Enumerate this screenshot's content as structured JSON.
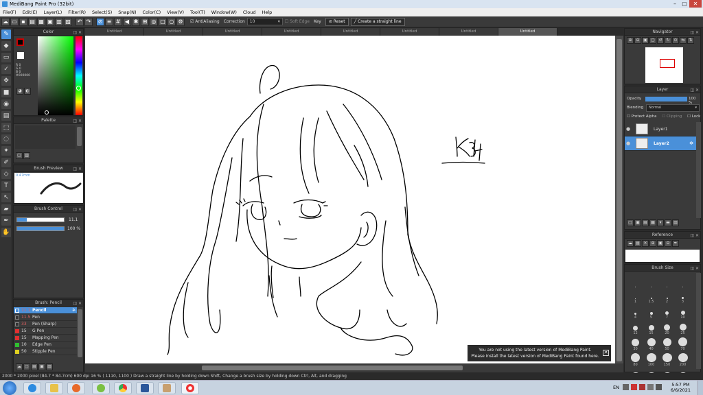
{
  "window": {
    "title": "MediBang Paint Pro (32bit)",
    "minimize": "–",
    "maximize": "▢",
    "close": "✕"
  },
  "menu": [
    "File(F)",
    "Edit(E)",
    "Layer(L)",
    "Filter(R)",
    "Select(S)",
    "Snap(N)",
    "Color(C)",
    "View(V)",
    "Tool(T)",
    "Window(W)",
    "Cloud",
    "Help"
  ],
  "toolbar": {
    "antialias_label": "AntiAliasing",
    "correction_label": "Correction",
    "correction_value": "10",
    "soft_edge_label": "Soft Edge",
    "key_label": "Key",
    "reset_label": "Reset",
    "straight_line_label": "Create a straight line"
  },
  "tabs": [
    "Untitled",
    "Untitled",
    "Untitled",
    "Untitled",
    "Untitled",
    "Untitled",
    "Untitled",
    "Untitled"
  ],
  "color_panel": {
    "title": "Color",
    "r": "R 0",
    "g": "G 0",
    "b": "B 0",
    "hex": "#000000"
  },
  "palette_panel": {
    "title": "Palette"
  },
  "brush_preview": {
    "title": "Brush Preview",
    "size": "0.47mm"
  },
  "brush_control": {
    "title": "Brush Control",
    "size_value": "11.1",
    "opacity_value": "100 %"
  },
  "brush_list": {
    "title": "Brush: Pencil",
    "items": [
      {
        "size": "11.1",
        "name": "Pencil",
        "color": "#4a90d9"
      },
      {
        "size": "11.5",
        "name": "Pen",
        "color": "#333333"
      },
      {
        "size": "33",
        "name": "Pen (Sharp)",
        "color": "#333333"
      },
      {
        "size": "15",
        "name": "G Pen",
        "color": "#e03030"
      },
      {
        "size": "15",
        "name": "Mapping Pen",
        "color": "#e03030"
      },
      {
        "size": "10",
        "name": "Edge Pen",
        "color": "#30c030"
      },
      {
        "size": "50",
        "name": "Stipple Pen",
        "color": "#e0d020"
      }
    ]
  },
  "navigator": {
    "title": "Navigator"
  },
  "layer_panel": {
    "title": "Layer",
    "opacity_label": "Opacity",
    "opacity_value": "100 %",
    "blending_label": "Blending",
    "blending_value": "Normal",
    "protect_alpha": "Protect Alpha",
    "clipping": "Clipping",
    "lock": "Lock",
    "layers": [
      {
        "name": "Layer1"
      },
      {
        "name": "Layer2"
      }
    ]
  },
  "reference": {
    "title": "Reference"
  },
  "brush_size": {
    "title": "Brush Size",
    "sizes": [
      "",
      "",
      "",
      "",
      "1",
      "1.5",
      "2",
      "3",
      "4",
      "5",
      "7",
      "10",
      "12",
      "15",
      "20",
      "25",
      "30",
      "40",
      "50",
      "70",
      "80",
      "100",
      "150",
      "200",
      "",
      "",
      "",
      ""
    ]
  },
  "notice": {
    "line1": "You are not using the latest version of MediBang Paint.",
    "line2": "Please install the latest version of MediBang Paint found here."
  },
  "status": "2000 * 2000 pixel  (84.7 * 84.7cm)  600 dpi  16 %  ( 1110, 1100 )  Draw a straight line by holding down Shift, Change a brush size by holding down Ctrl, Alt, and dragging",
  "taskbar": {
    "lang": "EN",
    "time": "5:57 PM",
    "date": "6/6/2021"
  },
  "colors": {
    "accent": "#4a90d9",
    "panel_bg": "#3a3a3a",
    "canvas_bg": "#ffffff"
  }
}
